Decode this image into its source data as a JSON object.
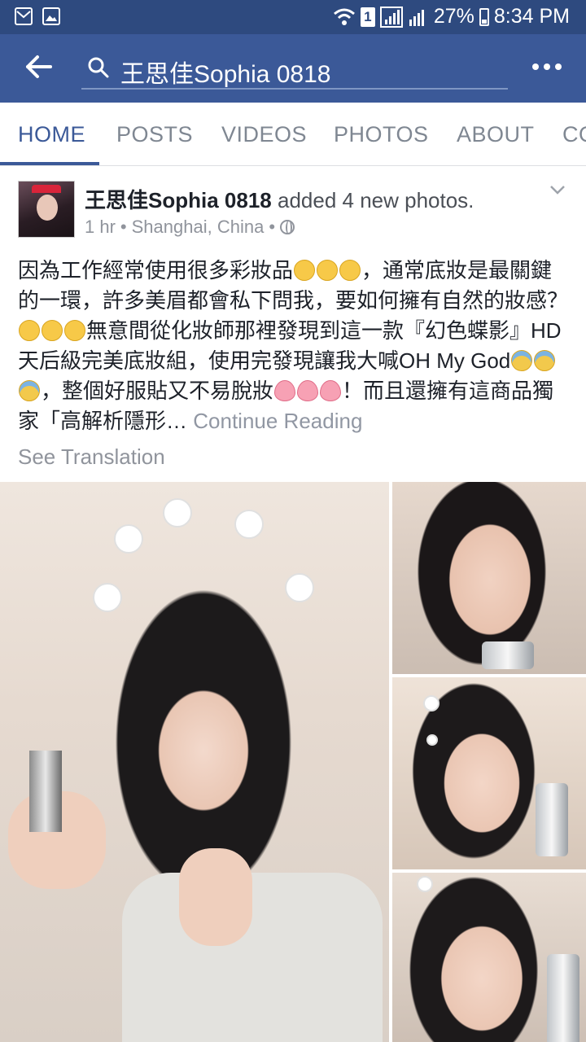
{
  "status_bar": {
    "battery": "27%",
    "time": "8:34 PM",
    "sim": "1",
    "icons": [
      "mail-icon",
      "image-icon",
      "wifi-icon",
      "signal-icon",
      "signal-r-icon",
      "battery-charging-icon"
    ]
  },
  "app_bar": {
    "search_query": "王思佳Sophia 0818",
    "icons": [
      "back-arrow-icon",
      "search-icon",
      "more-icon"
    ]
  },
  "tabs": [
    "HOME",
    "POSTS",
    "VIDEOS",
    "PHOTOS",
    "ABOUT",
    "CO"
  ],
  "active_tab": "HOME",
  "post": {
    "author": "王思佳Sophia 0818",
    "action": "added 4 new photos.",
    "time": "1 hr",
    "location": "Shanghai, China",
    "separator": "•",
    "privacy_icon": "globe-icon",
    "text_1": "因為工作經常使用很多彩妝品",
    "text_2": "，通常底妝是最關鍵的一環，許多美眉都會私下問我，要如何擁有自然的妝感？",
    "text_3": "無意間從化妝師那裡發現到這一款『幻色蝶影』HD天后級完美底妝組，使用完發現讓我大喊OH My God",
    "text_4": "，整個好服貼又不易脫妝",
    "text_5": "！而且還擁有這商品獨家「高解析隱形…",
    "continue_reading": "Continue Reading",
    "see_translation": "See Translation",
    "photo_count": 4
  },
  "colors": {
    "status_bar": "#2e4a7f",
    "app_bar": "#3b5998",
    "active_tab": "#3b5998",
    "muted_text": "#90949c"
  }
}
